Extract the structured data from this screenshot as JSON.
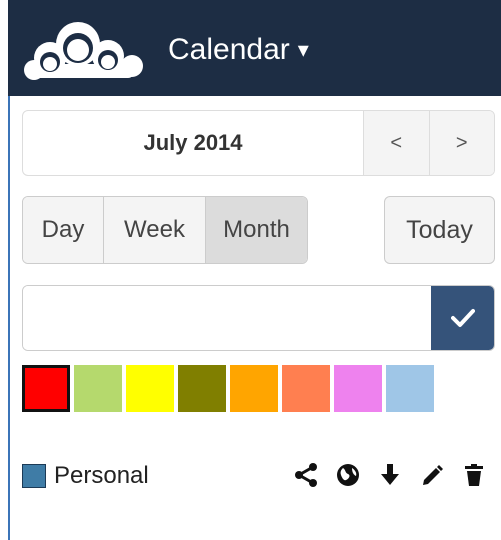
{
  "header": {
    "app_title": "Calendar",
    "logo_icon": "owncloud-cloud-logo",
    "menu_icon": "caret-down-icon",
    "background": "#1d2d44"
  },
  "navigation": {
    "current_month": "July 2014",
    "prev_label": "<",
    "next_label": ">"
  },
  "views": {
    "day_label": "Day",
    "week_label": "Week",
    "month_label": "Month",
    "active": "Month",
    "today_label": "Today"
  },
  "new_calendar": {
    "value": "",
    "placeholder": "",
    "confirm_icon": "checkmark-icon",
    "confirm_color": "#35537a"
  },
  "color_swatches": [
    {
      "color": "#ff0000",
      "selected": true
    },
    {
      "color": "#b5d96d",
      "selected": false
    },
    {
      "color": "#ffff00",
      "selected": false
    },
    {
      "color": "#807f00",
      "selected": false
    },
    {
      "color": "#ffa500",
      "selected": false
    },
    {
      "color": "#ff7f50",
      "selected": false
    },
    {
      "color": "#ee82ee",
      "selected": false
    },
    {
      "color": "#9fc6e7",
      "selected": false
    }
  ],
  "calendars": [
    {
      "name": "Personal",
      "color": "#3f7ca6",
      "actions": [
        "share-icon",
        "globe-icon",
        "download-icon",
        "edit-pencil-icon",
        "delete-trash-icon"
      ]
    }
  ]
}
